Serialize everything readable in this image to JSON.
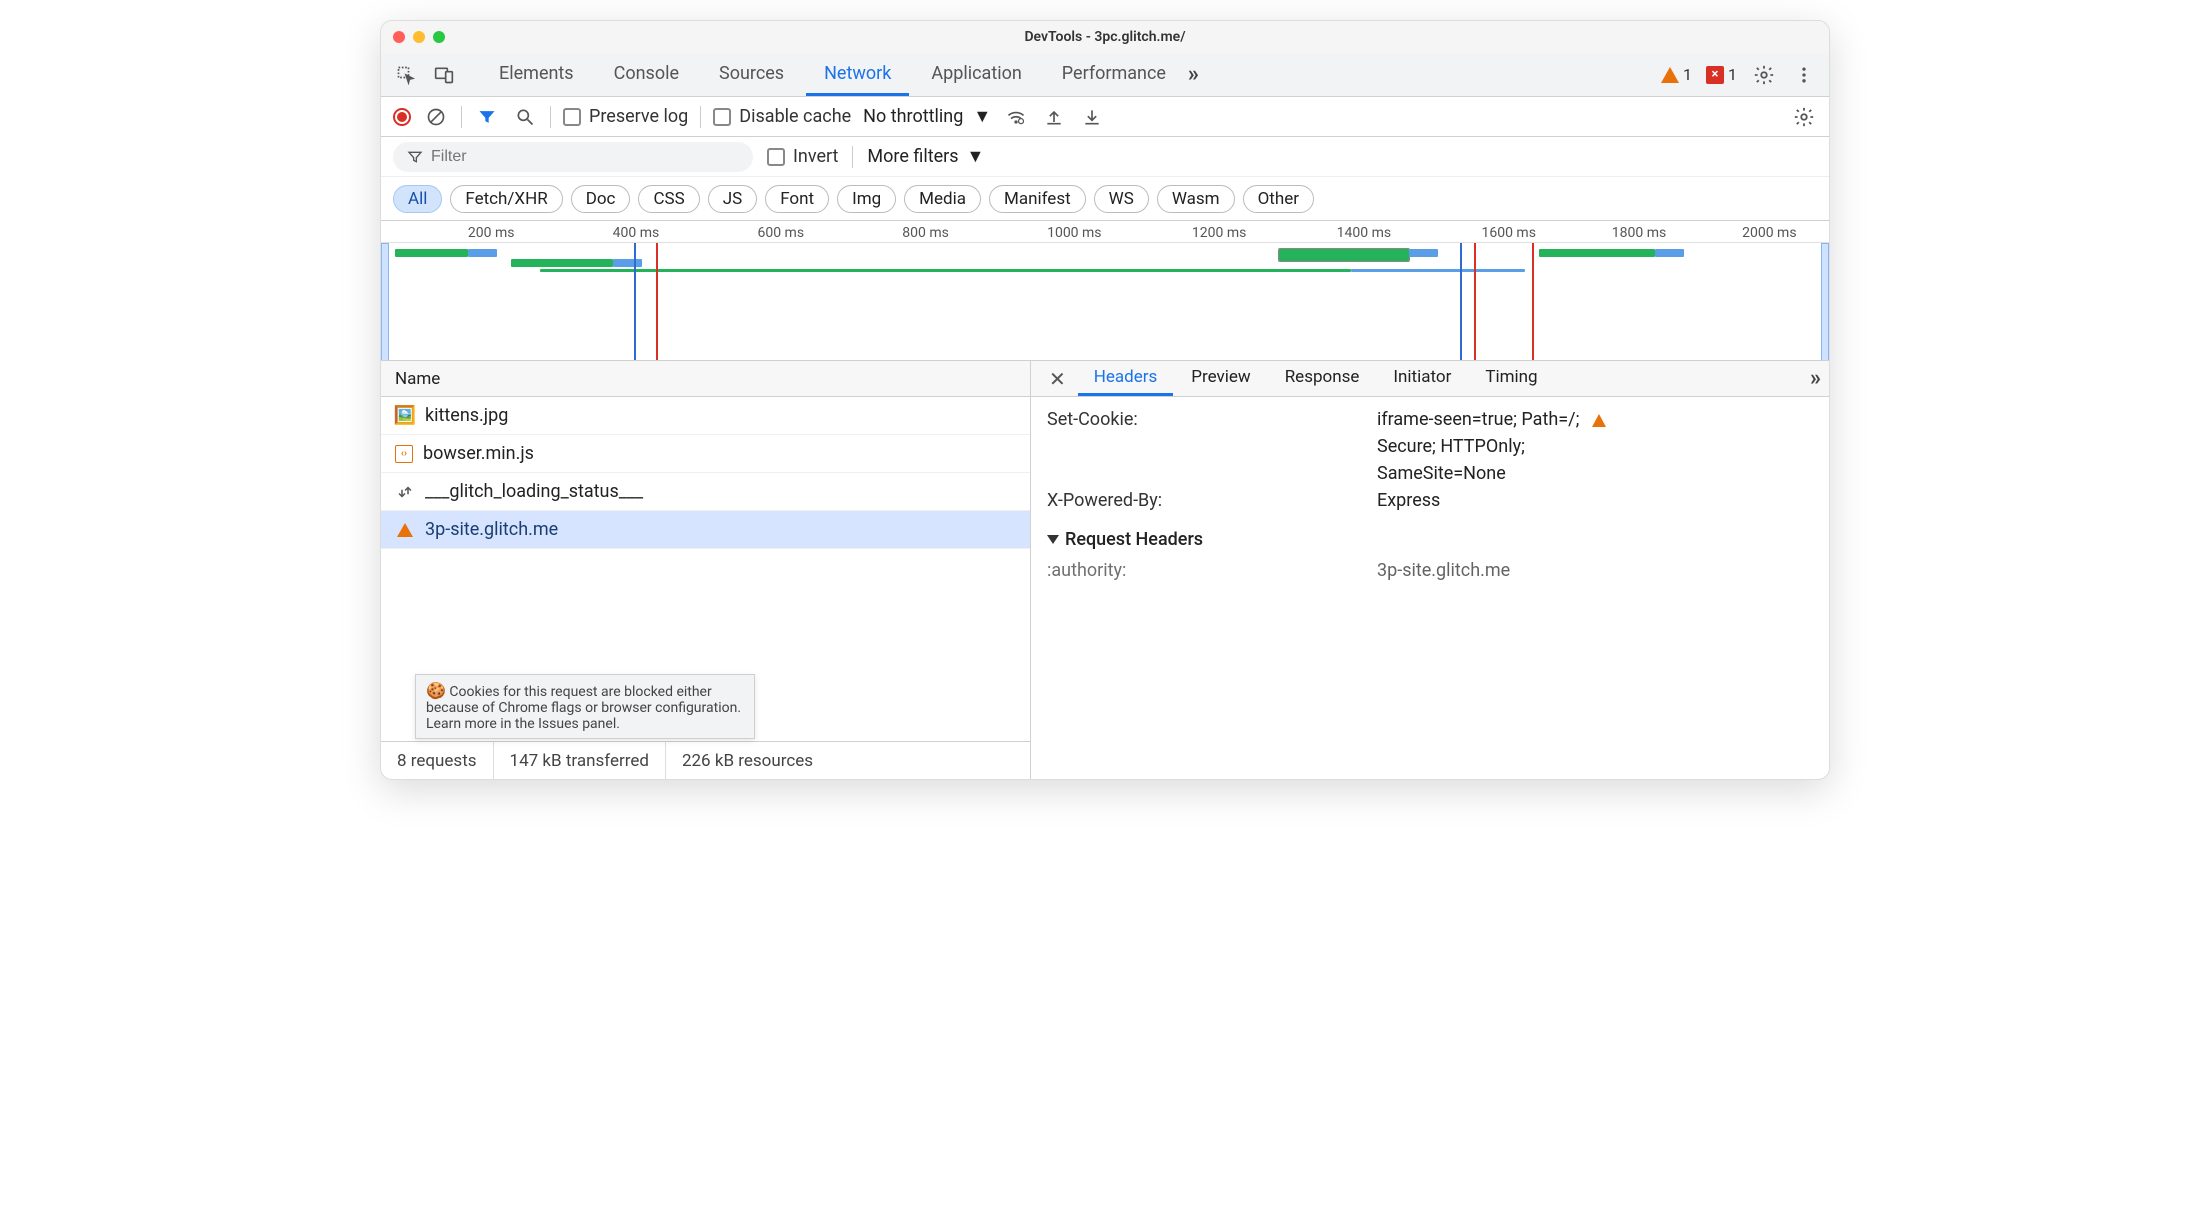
{
  "window": {
    "title": "DevTools - 3pc.glitch.me/"
  },
  "tabs": {
    "items": [
      "Elements",
      "Console",
      "Sources",
      "Network",
      "Application",
      "Performance"
    ],
    "active": "Network",
    "overflow": "»",
    "warn_count": "1",
    "err_count": "1",
    "err_sym": "×"
  },
  "toolbar": {
    "preserve_label": "Preserve log",
    "disable_cache_label": "Disable cache",
    "throttle_label": "No throttling"
  },
  "filterbar": {
    "filter_placeholder": "Filter",
    "invert_label": "Invert",
    "more_filters_label": "More filters"
  },
  "type_chips": [
    "All",
    "Fetch/XHR",
    "Doc",
    "CSS",
    "JS",
    "Font",
    "Img",
    "Media",
    "Manifest",
    "WS",
    "Wasm",
    "Other"
  ],
  "type_chip_active": "All",
  "timeline": {
    "ticks": [
      "200 ms",
      "400 ms",
      "600 ms",
      "800 ms",
      "1000 ms",
      "1200 ms",
      "1400 ms",
      "1600 ms",
      "1800 ms",
      "2000 ms"
    ]
  },
  "requests": {
    "header": "Name",
    "rows": [
      {
        "icon": "img",
        "name": "kittens.jpg"
      },
      {
        "icon": "js",
        "name": "bowser.min.js"
      },
      {
        "icon": "xhr",
        "name": "___glitch_loading_status___"
      },
      {
        "icon": "warn",
        "name": "3p-site.glitch.me",
        "selected": true
      }
    ]
  },
  "tooltip": {
    "text": "Cookies for this request are blocked either because of Chrome flags or browser configuration. Learn more in the Issues panel."
  },
  "status": {
    "requests": "8 requests",
    "transferred": "147 kB transferred",
    "resources": "226 kB resources"
  },
  "detail": {
    "tabs": [
      "Headers",
      "Preview",
      "Response",
      "Initiator",
      "Timing"
    ],
    "active": "Headers",
    "overflow": "»",
    "response_headers": [
      {
        "name": "Set-Cookie:",
        "value": "iframe-seen=true; Path=/;",
        "warn": true,
        "cont": [
          "Secure; HTTPOnly;",
          "SameSite=None"
        ]
      },
      {
        "name": "X-Powered-By:",
        "value": "Express"
      }
    ],
    "request_section": "Request Headers",
    "request_headers": [
      {
        "name": ":authority:",
        "value": "3p-site.glitch.me"
      }
    ]
  }
}
